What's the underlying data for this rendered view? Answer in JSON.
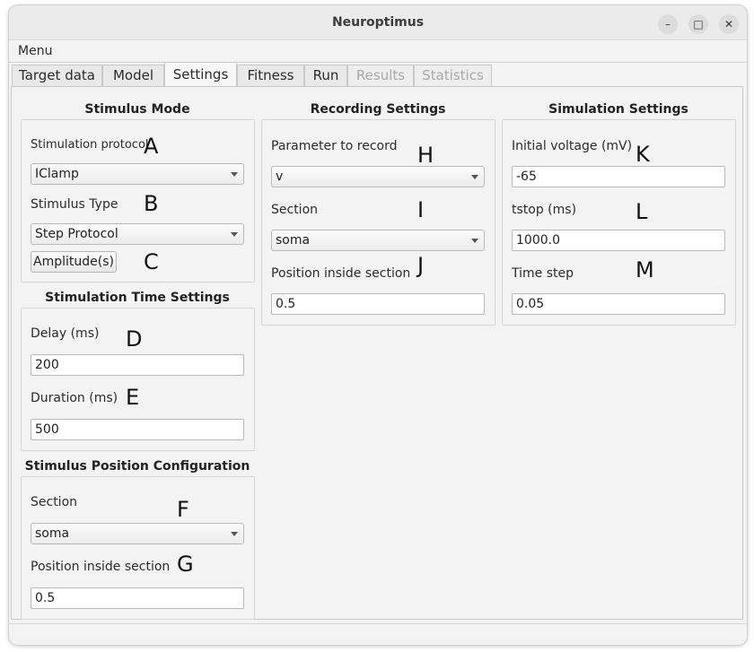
{
  "window": {
    "title": "Neuroptimus",
    "controls": {
      "minimize": "–",
      "maximize": "□",
      "close": "✕"
    }
  },
  "menubar": {
    "menu_label": "Menu"
  },
  "tabs": [
    {
      "label": "Target data",
      "state": "normal"
    },
    {
      "label": "Model",
      "state": "normal"
    },
    {
      "label": "Settings",
      "state": "active"
    },
    {
      "label": "Fitness",
      "state": "normal"
    },
    {
      "label": "Run",
      "state": "normal"
    },
    {
      "label": "Results",
      "state": "disabled"
    },
    {
      "label": "Statistics",
      "state": "disabled"
    }
  ],
  "stimulus_mode": {
    "title": "Stimulus Mode",
    "protocol_label": "Stimulation protocol",
    "protocol_value": "IClamp",
    "type_label": "Stimulus Type",
    "type_value": "Step Protocol",
    "amplitude_button": "Amplitude(s)"
  },
  "stim_time": {
    "title": "Stimulation Time Settings",
    "delay_label": "Delay (ms)",
    "delay_value": "200",
    "duration_label": "Duration (ms)",
    "duration_value": "500"
  },
  "stim_position": {
    "title": "Stimulus Position Configuration",
    "section_label": "Section",
    "section_value": "soma",
    "position_label": "Position inside section",
    "position_value": "0.5"
  },
  "recording": {
    "title": "Recording Settings",
    "parameter_label": "Parameter to record",
    "parameter_value": "v",
    "section_label": "Section",
    "section_value": "soma",
    "position_label": "Position inside section",
    "position_value": "0.5"
  },
  "simulation": {
    "title": "Simulation Settings",
    "voltage_label": "Initial voltage (mV)",
    "voltage_value": "-65",
    "tstop_label": "tstop (ms)",
    "tstop_value": "1000.0",
    "timestep_label": "Time step",
    "timestep_value": "0.05"
  },
  "annotations": {
    "A": "A",
    "B": "B",
    "C": "C",
    "D": "D",
    "E": "E",
    "F": "F",
    "G": "G",
    "H": "H",
    "I": "I",
    "J": "J",
    "K": "K",
    "L": "L",
    "M": "M"
  }
}
